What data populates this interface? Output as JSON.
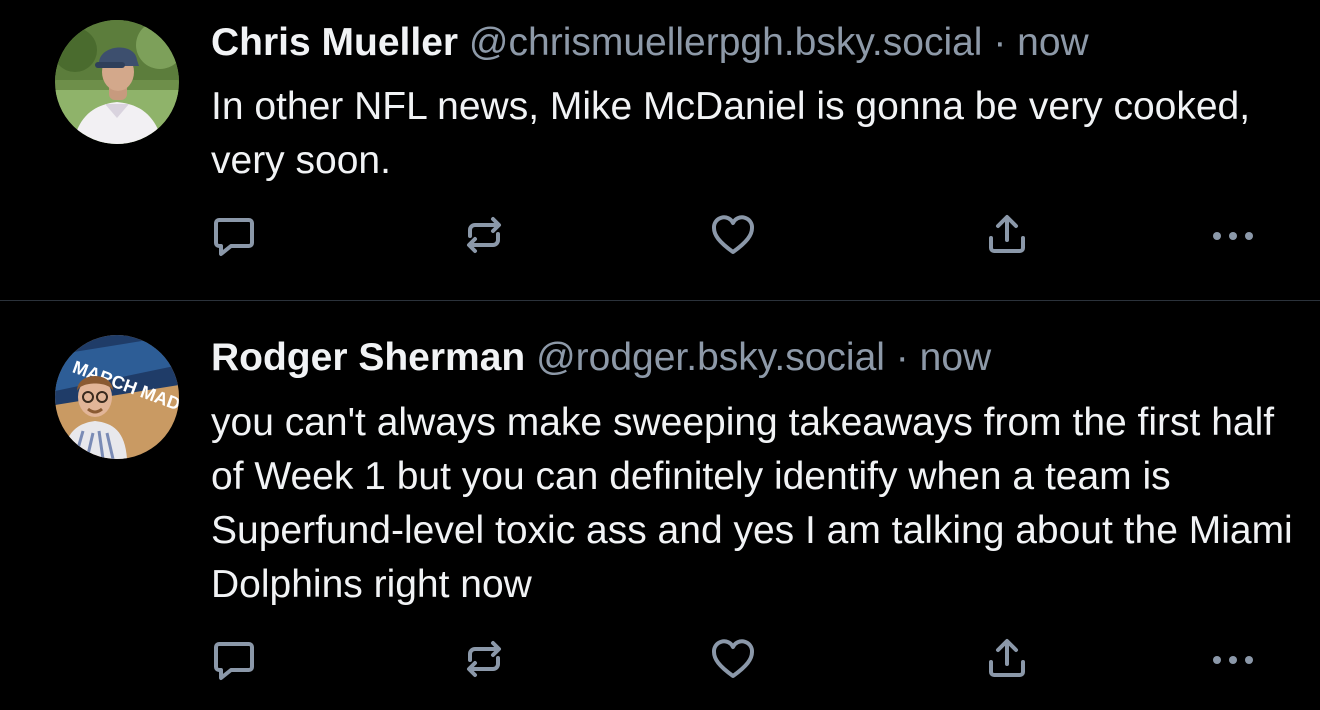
{
  "colors": {
    "background": "#000000",
    "text": "#f1f3f5",
    "muted": "#8d99a8",
    "icon": "#8b98a9",
    "divider": "#2b323b"
  },
  "posts": [
    {
      "author_name": "Chris Mueller",
      "handle": "@chrismuellerpgh.bsky.social",
      "separator": "·",
      "time": "now",
      "text": "In other NFL news, Mike McDaniel is gonna be very cooked, very soon.",
      "actions": [
        "reply-icon",
        "repost-icon",
        "like-icon",
        "share-icon",
        "more-icon"
      ]
    },
    {
      "author_name": "Rodger Sherman",
      "handle": "@rodger.bsky.social",
      "separator": "·",
      "time": "now",
      "text": "you can't always make sweeping takeaways from the first half of Week 1 but you can definitely identify when a team is Superfund-level toxic ass and yes I am talking about the Miami Dolphins right now",
      "avatar_logo_text": "MARCH MADNESS",
      "actions": [
        "reply-icon",
        "repost-icon",
        "like-icon",
        "share-icon",
        "more-icon"
      ]
    }
  ]
}
